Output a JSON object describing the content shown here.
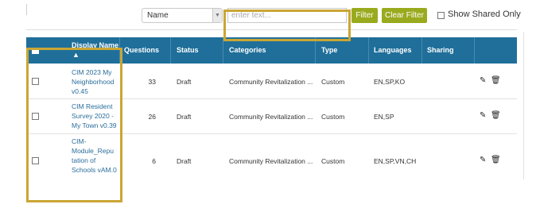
{
  "toolbar": {
    "field_select": "Name",
    "filter_placeholder": "enter text...",
    "filter_button": "Filter",
    "clear_button": "Clear Filter",
    "show_shared_label": "Show Shared Only"
  },
  "table": {
    "headers": {
      "display_name": "Display Name",
      "questions": "Questions",
      "status": "Status",
      "categories": "Categories",
      "type": "Type",
      "languages": "Languages",
      "sharing": "Sharing"
    },
    "sort_indicator": "^",
    "rows": [
      {
        "name_lines": [
          "CIM 2023 My",
          "Neighborhood",
          "v0.45"
        ],
        "questions": "33",
        "status": "Draft",
        "category": "Community Revitalization ...",
        "type": "Custom",
        "languages": "EN,SP,KO"
      },
      {
        "name_lines": [
          "CIM Resident",
          "Survey 2020 -",
          "My Town v0.39"
        ],
        "questions": "26",
        "status": "Draft",
        "category": "Community Revitalization ...",
        "type": "Custom",
        "languages": "EN,SP"
      },
      {
        "name_lines": [
          "CIM-",
          "Module_Repu",
          "tation of",
          "Schools vAM.0"
        ],
        "questions": "6",
        "status": "Draft",
        "category": "Community Revitalization ...",
        "type": "Custom",
        "languages": "EN,SP,VN,CH"
      }
    ]
  },
  "icons": {
    "edit": "pencil-icon",
    "delete": "trash-icon",
    "dropdown": "caret-down-icon"
  },
  "colors": {
    "header_bg": "#1f6f9a",
    "button_bg": "#9aaa1e",
    "link": "#2b6e9c",
    "highlight": "#caa634"
  }
}
